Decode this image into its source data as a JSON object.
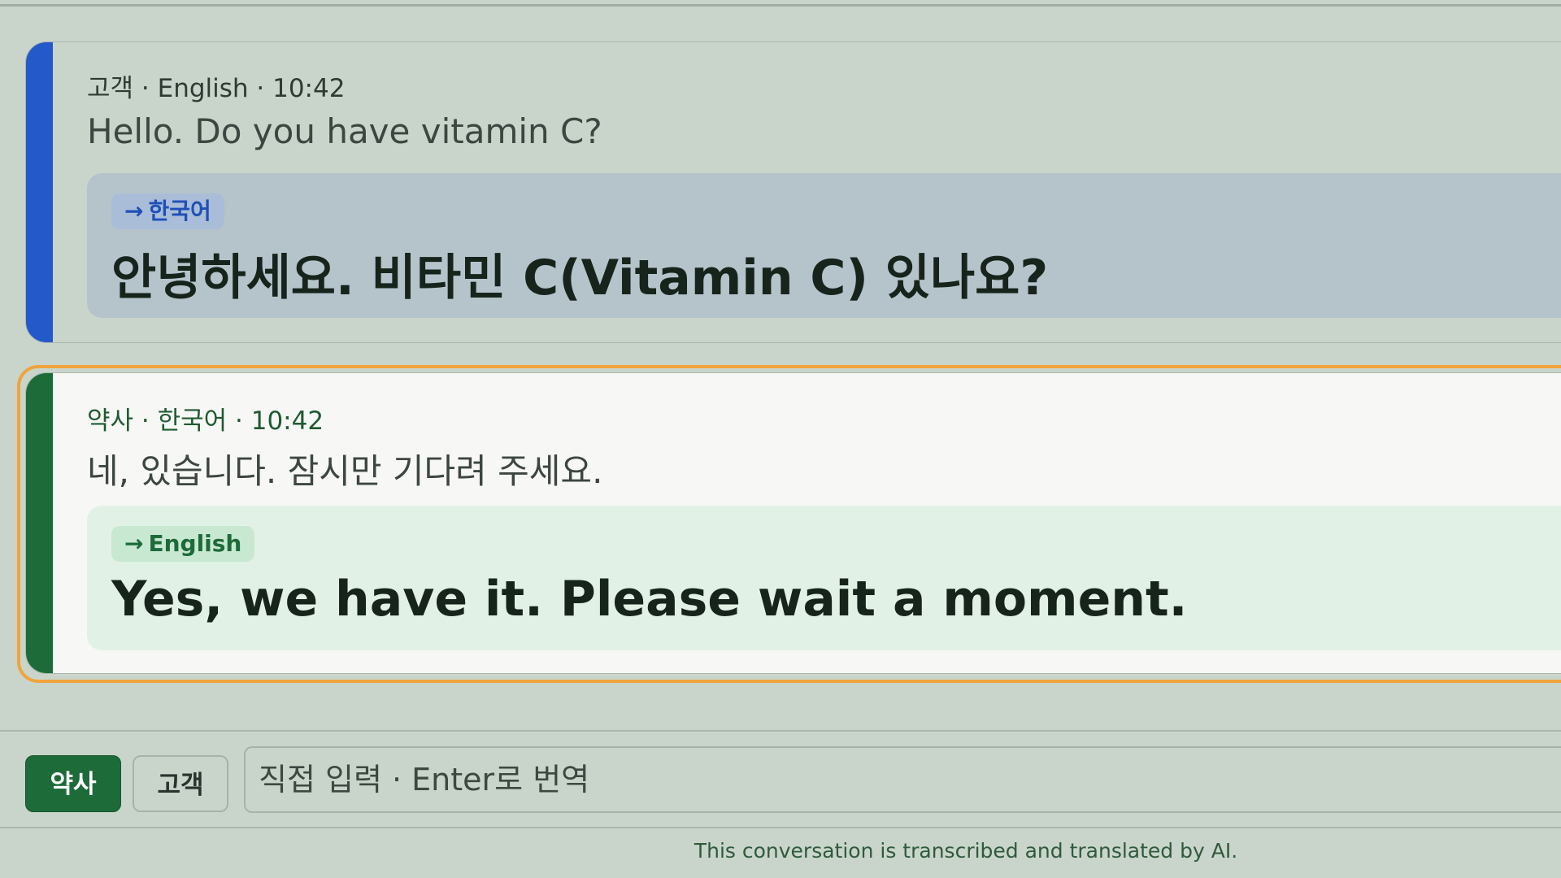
{
  "messages": [
    {
      "speaker": "고객",
      "language": "English",
      "time": "10:42",
      "meta": "고객 · English · 10:42",
      "original": "Hello. Do you have vitamin C?",
      "target_language": "한국어",
      "translation": "안녕하세요. 비타민 C(Vitamin C) 있나요?",
      "accent_color": "#2359c9"
    },
    {
      "speaker": "약사",
      "language": "한국어",
      "time": "10:42",
      "meta": "약사 · 한국어 · 10:42",
      "original": "네, 있습니다. 잠시만 기다려 주세요.",
      "target_language": "English",
      "translation": "Yes, we have it. Please wait a moment.",
      "accent_color": "#1d6b39",
      "selected": true
    }
  ],
  "input_bar": {
    "speaker_buttons": [
      {
        "label": "약사",
        "active": true
      },
      {
        "label": "고객",
        "active": false
      }
    ],
    "placeholder": "직접 입력 · Enter로 번역"
  },
  "arrow_icon": "→",
  "footer": {
    "disclaimer": "This conversation is transcribed and translated by AI."
  },
  "colors": {
    "background": "#c9d5cb",
    "selection_ring": "#f0a43c",
    "pharmacist_accent": "#1d6b39",
    "customer_accent": "#2359c9"
  }
}
